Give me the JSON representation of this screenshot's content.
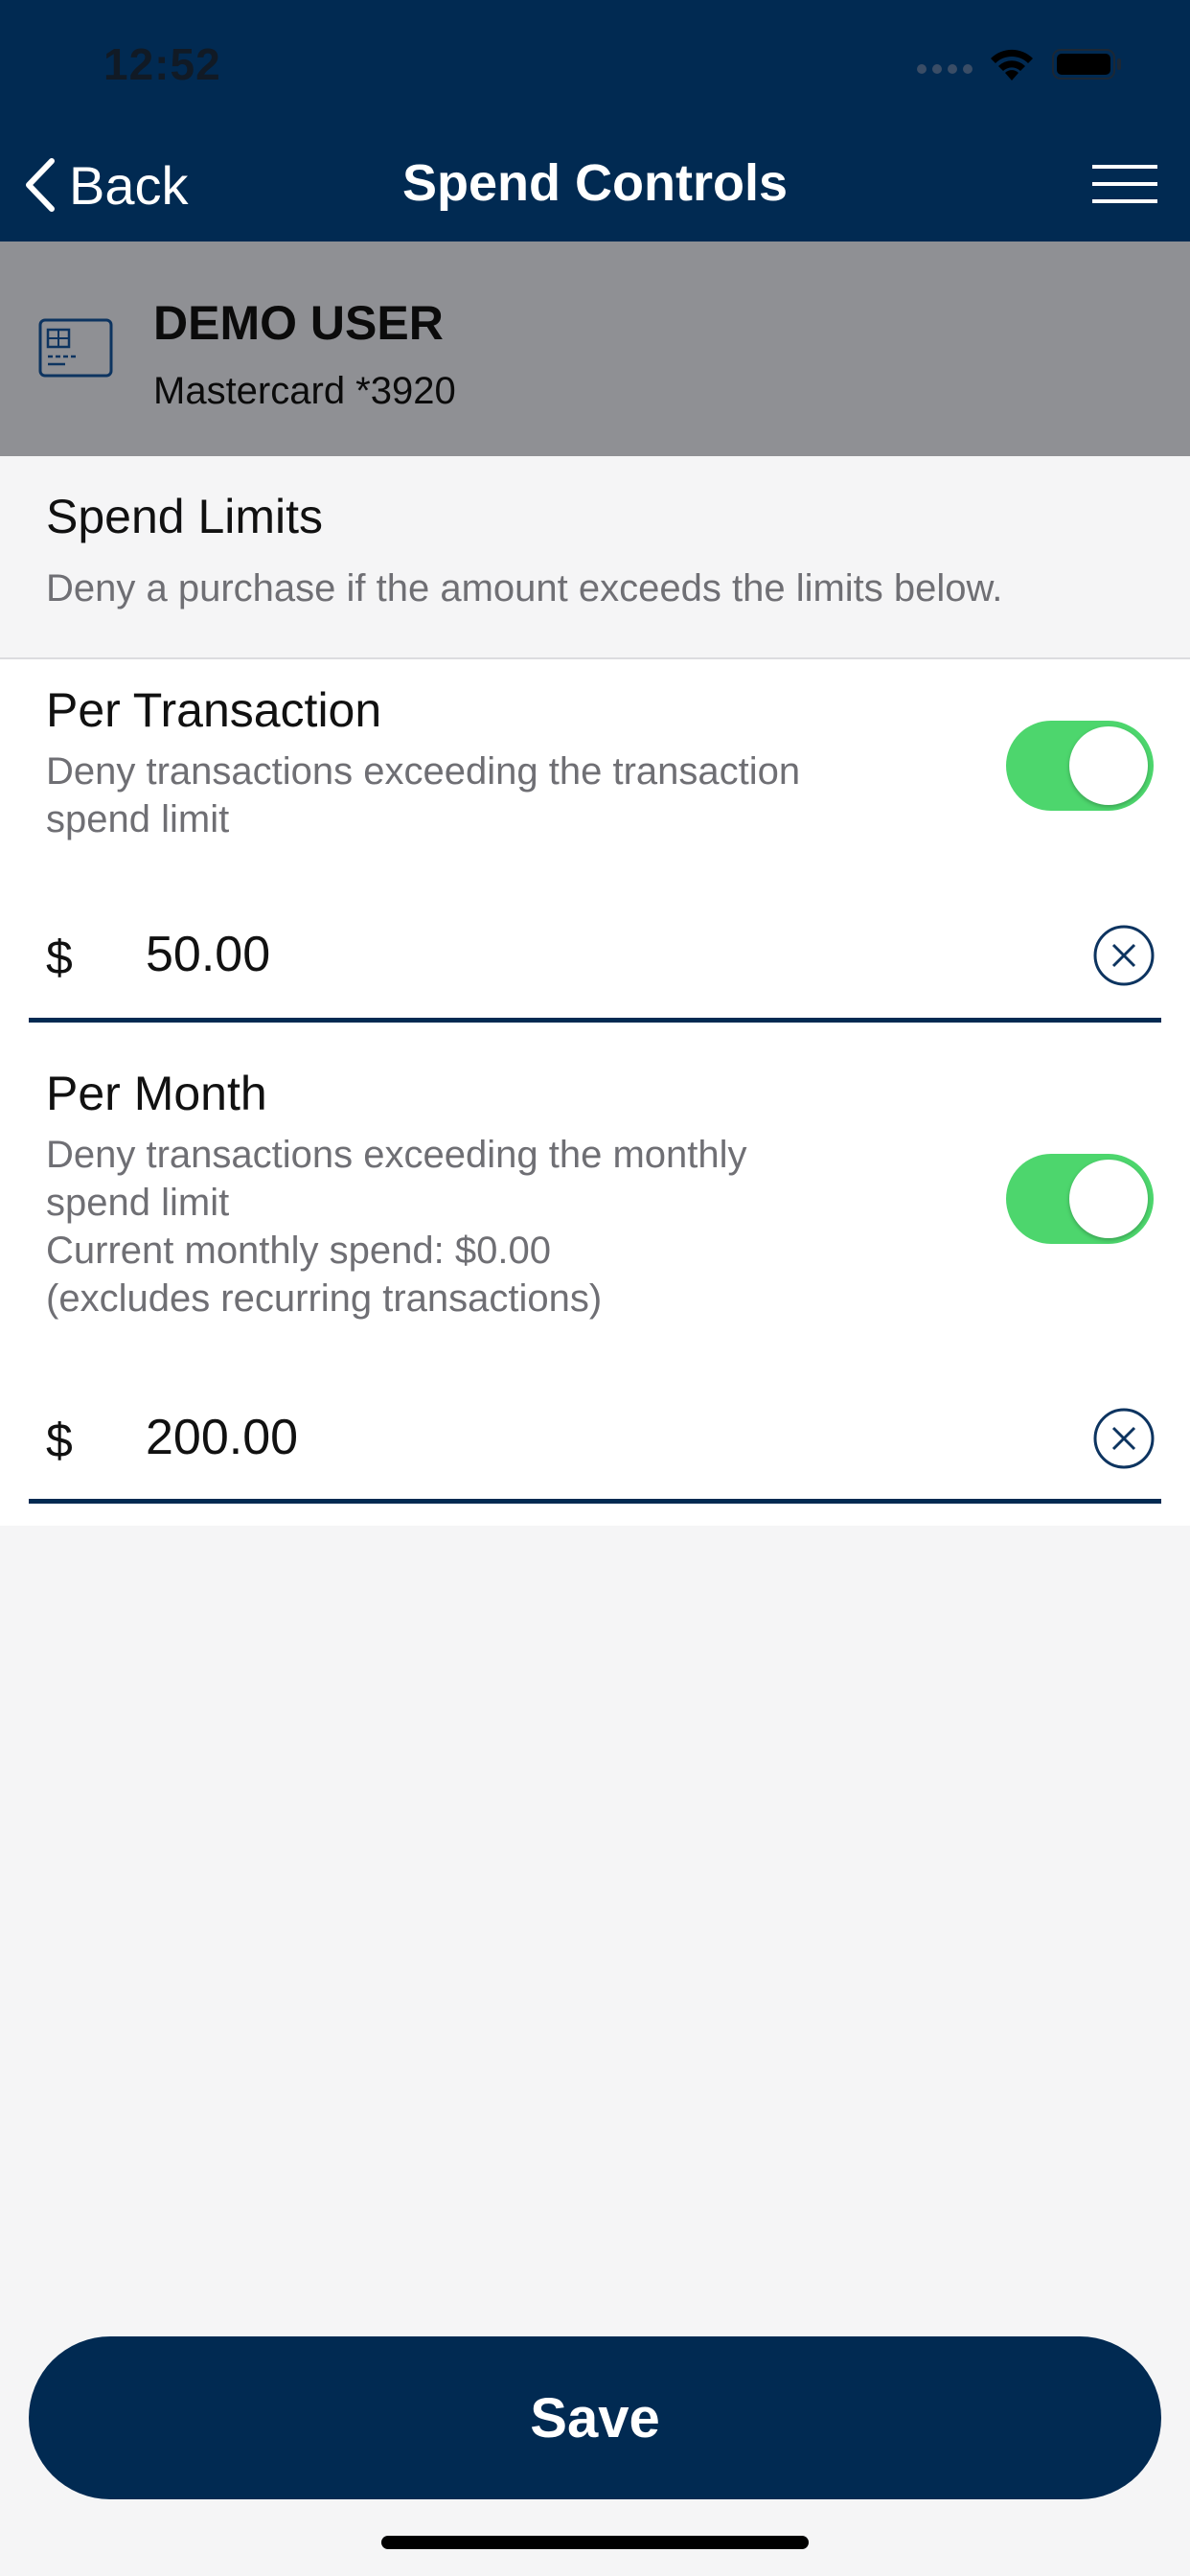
{
  "status_bar": {
    "time": "12:52"
  },
  "nav": {
    "back_label": "Back",
    "title": "Spend Controls"
  },
  "card": {
    "name": "DEMO USER",
    "number": "Mastercard *3920"
  },
  "spend_limits": {
    "title": "Spend Limits",
    "description": "Deny a purchase if the amount exceeds the limits below.",
    "per_transaction": {
      "title": "Per Transaction",
      "description": "Deny transactions exceeding the transaction spend limit",
      "enabled": true,
      "currency": "$",
      "amount": "50.00"
    },
    "per_month": {
      "title": "Per Month",
      "description_line1": "Deny transactions exceeding the monthly spend limit",
      "description_line2": "Current monthly spend: $0.00",
      "description_line3": "(excludes recurring transactions)",
      "enabled": true,
      "currency": "$",
      "amount": "200.00"
    }
  },
  "actions": {
    "save_label": "Save"
  },
  "colors": {
    "primary": "#012a52",
    "toggle_on": "#4dd66d",
    "card_band": "#8f9094",
    "secondary_text": "#6f6f74"
  },
  "icons": {
    "back": "chevron-left-icon",
    "menu": "hamburger-menu-icon",
    "card": "credit-card-icon",
    "clear": "clear-circle-icon",
    "wifi": "wifi-icon",
    "battery": "battery-icon",
    "signal": "cellular-signal-icon"
  }
}
